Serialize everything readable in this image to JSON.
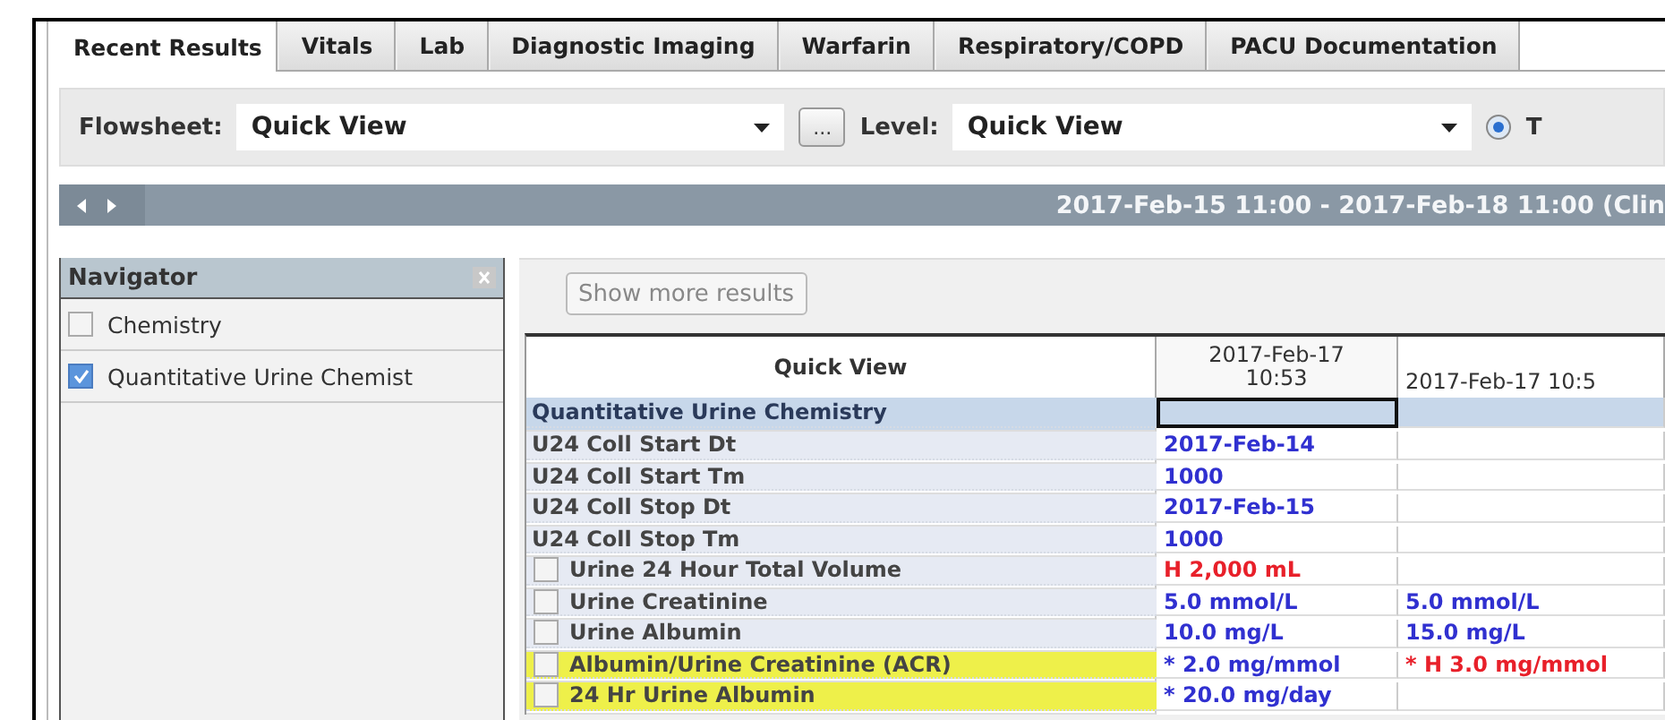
{
  "tabs": [
    {
      "label": "Recent Results",
      "selected": true
    },
    {
      "label": "Vitals",
      "selected": false
    },
    {
      "label": "Lab",
      "selected": false
    },
    {
      "label": "Diagnostic Imaging",
      "selected": false
    },
    {
      "label": "Warfarin",
      "selected": false
    },
    {
      "label": "Respiratory/COPD",
      "selected": false
    },
    {
      "label": "PACU Documentation",
      "selected": false
    }
  ],
  "filter_bar": {
    "flowsheet_label": "Flowsheet:",
    "flowsheet_value": "Quick View",
    "more_button": "...",
    "level_label": "Level:",
    "level_value": "Quick View",
    "radio": {
      "label": "T",
      "selected": true
    }
  },
  "date_bar": {
    "range": "2017-Feb-15 11:00 - 2017-Feb-18 11:00 (Clin"
  },
  "navigator": {
    "title": "Navigator",
    "items": [
      {
        "label": "Chemistry",
        "checked": false
      },
      {
        "label": "Quantitative Urine Chemist",
        "checked": true
      }
    ]
  },
  "show_more_button": "Show more results",
  "table": {
    "columns": [
      "Quick View",
      "2017-Feb-17 10:53",
      "2017-Feb-17 10:5"
    ],
    "rows": [
      {
        "kind": "section",
        "label": "Quantitative Urine Chemistry",
        "highlighted": false,
        "values": []
      },
      {
        "kind": "plain",
        "label": "U24 Coll Start Dt",
        "highlighted": false,
        "values": [
          {
            "text": "2017-Feb-14",
            "abnormal": false
          }
        ]
      },
      {
        "kind": "plain",
        "label": "U24 Coll Start Tm",
        "highlighted": false,
        "values": [
          {
            "text": "1000",
            "abnormal": false
          }
        ]
      },
      {
        "kind": "plain",
        "label": "U24 Coll Stop Dt",
        "highlighted": false,
        "values": [
          {
            "text": "2017-Feb-15",
            "abnormal": false
          }
        ]
      },
      {
        "kind": "plain",
        "label": "U24 Coll Stop Tm",
        "highlighted": false,
        "values": [
          {
            "text": "1000",
            "abnormal": false
          }
        ]
      },
      {
        "kind": "check",
        "label": "Urine 24 Hour Total Volume",
        "highlighted": false,
        "values": [
          {
            "text": "H 2,000 mL",
            "abnormal": true
          }
        ]
      },
      {
        "kind": "check",
        "label": "Urine Creatinine",
        "highlighted": false,
        "values": [
          {
            "text": "5.0 mmol/L",
            "abnormal": false
          },
          {
            "text": "5.0 mmol/L",
            "abnormal": false
          }
        ]
      },
      {
        "kind": "check",
        "label": "Urine Albumin",
        "highlighted": false,
        "values": [
          {
            "text": "10.0 mg/L",
            "abnormal": false
          },
          {
            "text": "15.0 mg/L",
            "abnormal": false
          }
        ]
      },
      {
        "kind": "check",
        "label": "Albumin/Urine Creatinine (ACR)",
        "highlighted": true,
        "values": [
          {
            "text": "* 2.0 mg/mmol",
            "abnormal": false
          },
          {
            "text": "* H 3.0 mg/mmol",
            "abnormal": true
          }
        ]
      },
      {
        "kind": "check",
        "label": "24 Hr Urine Albumin",
        "highlighted": true,
        "values": [
          {
            "text": "* 20.0 mg/day",
            "abnormal": false
          }
        ]
      }
    ]
  }
}
